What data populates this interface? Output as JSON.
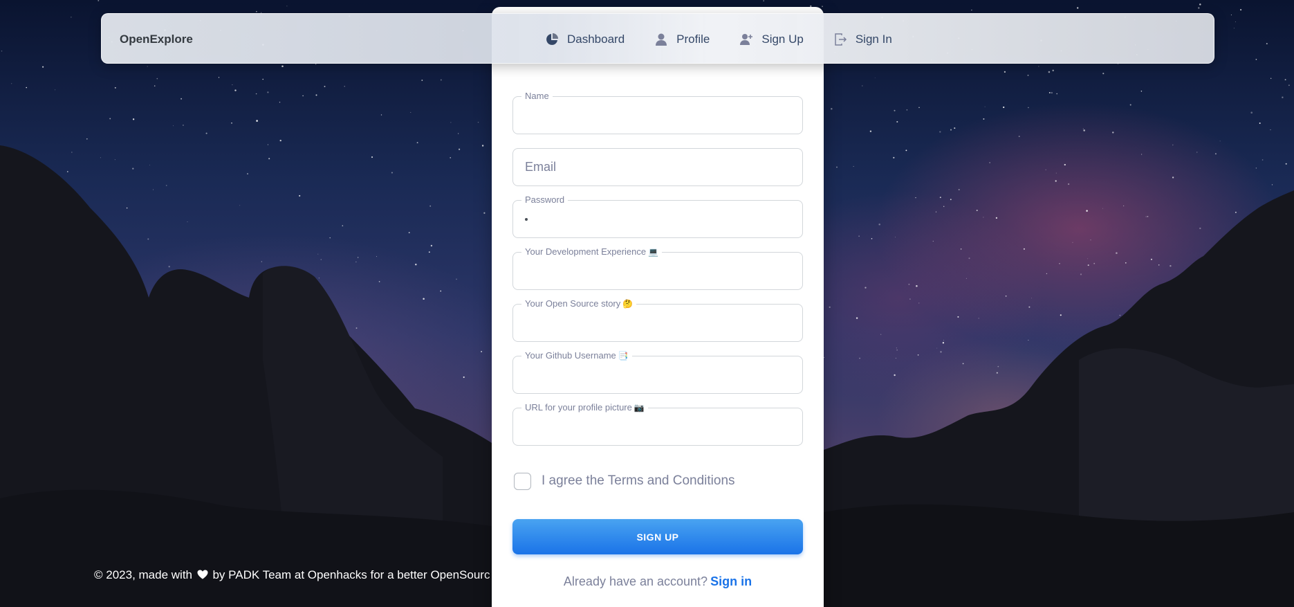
{
  "navbar": {
    "brand": "OpenExplore",
    "links": [
      {
        "label": "Dashboard",
        "icon": "pie-chart-icon"
      },
      {
        "label": "Profile",
        "icon": "person-icon"
      },
      {
        "label": "Sign Up",
        "icon": "person-add-icon"
      },
      {
        "label": "Sign In",
        "icon": "sign-in-icon"
      }
    ]
  },
  "form": {
    "name": {
      "label": "Name",
      "value": ""
    },
    "email": {
      "placeholder": "Email",
      "value": ""
    },
    "password": {
      "label": "Password",
      "masked_chars": 1
    },
    "experience": {
      "label": "Your Development Experience",
      "emoji": "💻",
      "value": ""
    },
    "story": {
      "label": "Your Open Source story",
      "emoji": "🤔",
      "value": ""
    },
    "github": {
      "label": "Your Github Username",
      "emoji": "📑",
      "value": ""
    },
    "picture": {
      "label": "URL for your profile picture",
      "emoji": "📷",
      "value": ""
    },
    "terms_label": "I agree the Terms and Conditions",
    "terms_checked": false,
    "submit_label": "SIGN UP",
    "signin_prompt": "Already have an account?",
    "signin_link": "Sign in"
  },
  "footer": {
    "prefix": "© 2023, made with",
    "suffix": "by PADK Team at Openhacks for a better OpenSourc"
  },
  "colors": {
    "accent": "#1a73e8",
    "text_muted": "#7b809a",
    "nav_text": "#344767"
  }
}
